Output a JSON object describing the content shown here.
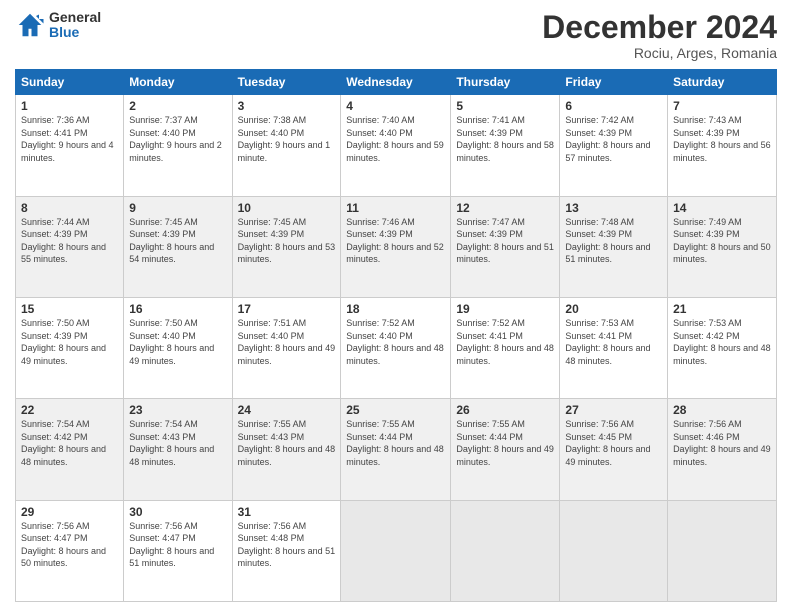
{
  "logo": {
    "general": "General",
    "blue": "Blue"
  },
  "header": {
    "month": "December 2024",
    "location": "Rociu, Arges, Romania"
  },
  "days_of_week": [
    "Sunday",
    "Monday",
    "Tuesday",
    "Wednesday",
    "Thursday",
    "Friday",
    "Saturday"
  ],
  "weeks": [
    [
      {
        "day": "1",
        "sunrise": "7:36 AM",
        "sunset": "4:41 PM",
        "daylight": "9 hours and 4 minutes."
      },
      {
        "day": "2",
        "sunrise": "7:37 AM",
        "sunset": "4:40 PM",
        "daylight": "9 hours and 2 minutes."
      },
      {
        "day": "3",
        "sunrise": "7:38 AM",
        "sunset": "4:40 PM",
        "daylight": "9 hours and 1 minute."
      },
      {
        "day": "4",
        "sunrise": "7:40 AM",
        "sunset": "4:40 PM",
        "daylight": "8 hours and 59 minutes."
      },
      {
        "day": "5",
        "sunrise": "7:41 AM",
        "sunset": "4:39 PM",
        "daylight": "8 hours and 58 minutes."
      },
      {
        "day": "6",
        "sunrise": "7:42 AM",
        "sunset": "4:39 PM",
        "daylight": "8 hours and 57 minutes."
      },
      {
        "day": "7",
        "sunrise": "7:43 AM",
        "sunset": "4:39 PM",
        "daylight": "8 hours and 56 minutes."
      }
    ],
    [
      {
        "day": "8",
        "sunrise": "7:44 AM",
        "sunset": "4:39 PM",
        "daylight": "8 hours and 55 minutes."
      },
      {
        "day": "9",
        "sunrise": "7:45 AM",
        "sunset": "4:39 PM",
        "daylight": "8 hours and 54 minutes."
      },
      {
        "day": "10",
        "sunrise": "7:45 AM",
        "sunset": "4:39 PM",
        "daylight": "8 hours and 53 minutes."
      },
      {
        "day": "11",
        "sunrise": "7:46 AM",
        "sunset": "4:39 PM",
        "daylight": "8 hours and 52 minutes."
      },
      {
        "day": "12",
        "sunrise": "7:47 AM",
        "sunset": "4:39 PM",
        "daylight": "8 hours and 51 minutes."
      },
      {
        "day": "13",
        "sunrise": "7:48 AM",
        "sunset": "4:39 PM",
        "daylight": "8 hours and 51 minutes."
      },
      {
        "day": "14",
        "sunrise": "7:49 AM",
        "sunset": "4:39 PM",
        "daylight": "8 hours and 50 minutes."
      }
    ],
    [
      {
        "day": "15",
        "sunrise": "7:50 AM",
        "sunset": "4:39 PM",
        "daylight": "8 hours and 49 minutes."
      },
      {
        "day": "16",
        "sunrise": "7:50 AM",
        "sunset": "4:40 PM",
        "daylight": "8 hours and 49 minutes."
      },
      {
        "day": "17",
        "sunrise": "7:51 AM",
        "sunset": "4:40 PM",
        "daylight": "8 hours and 49 minutes."
      },
      {
        "day": "18",
        "sunrise": "7:52 AM",
        "sunset": "4:40 PM",
        "daylight": "8 hours and 48 minutes."
      },
      {
        "day": "19",
        "sunrise": "7:52 AM",
        "sunset": "4:41 PM",
        "daylight": "8 hours and 48 minutes."
      },
      {
        "day": "20",
        "sunrise": "7:53 AM",
        "sunset": "4:41 PM",
        "daylight": "8 hours and 48 minutes."
      },
      {
        "day": "21",
        "sunrise": "7:53 AM",
        "sunset": "4:42 PM",
        "daylight": "8 hours and 48 minutes."
      }
    ],
    [
      {
        "day": "22",
        "sunrise": "7:54 AM",
        "sunset": "4:42 PM",
        "daylight": "8 hours and 48 minutes."
      },
      {
        "day": "23",
        "sunrise": "7:54 AM",
        "sunset": "4:43 PM",
        "daylight": "8 hours and 48 minutes."
      },
      {
        "day": "24",
        "sunrise": "7:55 AM",
        "sunset": "4:43 PM",
        "daylight": "8 hours and 48 minutes."
      },
      {
        "day": "25",
        "sunrise": "7:55 AM",
        "sunset": "4:44 PM",
        "daylight": "8 hours and 48 minutes."
      },
      {
        "day": "26",
        "sunrise": "7:55 AM",
        "sunset": "4:44 PM",
        "daylight": "8 hours and 49 minutes."
      },
      {
        "day": "27",
        "sunrise": "7:56 AM",
        "sunset": "4:45 PM",
        "daylight": "8 hours and 49 minutes."
      },
      {
        "day": "28",
        "sunrise": "7:56 AM",
        "sunset": "4:46 PM",
        "daylight": "8 hours and 49 minutes."
      }
    ],
    [
      {
        "day": "29",
        "sunrise": "7:56 AM",
        "sunset": "4:47 PM",
        "daylight": "8 hours and 50 minutes."
      },
      {
        "day": "30",
        "sunrise": "7:56 AM",
        "sunset": "4:47 PM",
        "daylight": "8 hours and 51 minutes."
      },
      {
        "day": "31",
        "sunrise": "7:56 AM",
        "sunset": "4:48 PM",
        "daylight": "8 hours and 51 minutes."
      },
      null,
      null,
      null,
      null
    ]
  ]
}
